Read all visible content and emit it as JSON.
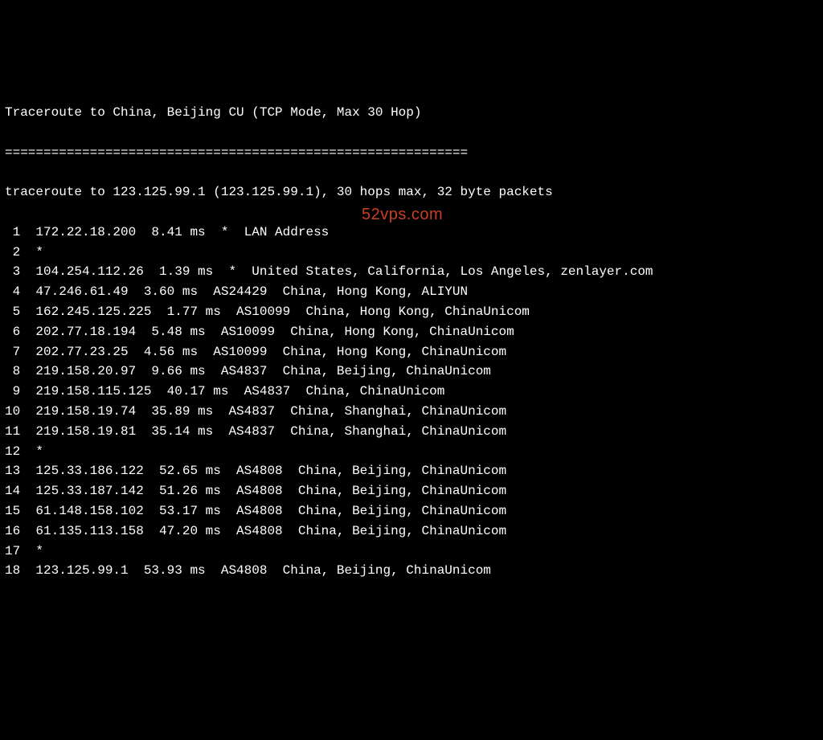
{
  "title": "Traceroute to China, Beijing CU (TCP Mode, Max 30 Hop)",
  "divider": "============================================================",
  "summary": "traceroute to 123.125.99.1 (123.125.99.1), 30 hops max, 32 byte packets",
  "watermark": "52vps.com",
  "hops": [
    {
      "num": "1",
      "ip": "172.22.18.200",
      "rtt": "8.41 ms",
      "asn": "*",
      "loc": "LAN Address"
    },
    {
      "num": "2",
      "ip": "*",
      "rtt": "",
      "asn": "",
      "loc": ""
    },
    {
      "num": "3",
      "ip": "104.254.112.26",
      "rtt": "1.39 ms",
      "asn": "*",
      "loc": "United States, California, Los Angeles, zenlayer.com"
    },
    {
      "num": "4",
      "ip": "47.246.61.49",
      "rtt": "3.60 ms",
      "asn": "AS24429",
      "loc": "China, Hong Kong, ALIYUN"
    },
    {
      "num": "5",
      "ip": "162.245.125.225",
      "rtt": "1.77 ms",
      "asn": "AS10099",
      "loc": "China, Hong Kong, ChinaUnicom"
    },
    {
      "num": "6",
      "ip": "202.77.18.194",
      "rtt": "5.48 ms",
      "asn": "AS10099",
      "loc": "China, Hong Kong, ChinaUnicom"
    },
    {
      "num": "7",
      "ip": "202.77.23.25",
      "rtt": "4.56 ms",
      "asn": "AS10099",
      "loc": "China, Hong Kong, ChinaUnicom"
    },
    {
      "num": "8",
      "ip": "219.158.20.97",
      "rtt": "9.66 ms",
      "asn": "AS4837",
      "loc": "China, Beijing, ChinaUnicom"
    },
    {
      "num": "9",
      "ip": "219.158.115.125",
      "rtt": "40.17 ms",
      "asn": "AS4837",
      "loc": "China, ChinaUnicom"
    },
    {
      "num": "10",
      "ip": "219.158.19.74",
      "rtt": "35.89 ms",
      "asn": "AS4837",
      "loc": "China, Shanghai, ChinaUnicom"
    },
    {
      "num": "11",
      "ip": "219.158.19.81",
      "rtt": "35.14 ms",
      "asn": "AS4837",
      "loc": "China, Shanghai, ChinaUnicom"
    },
    {
      "num": "12",
      "ip": "*",
      "rtt": "",
      "asn": "",
      "loc": ""
    },
    {
      "num": "13",
      "ip": "125.33.186.122",
      "rtt": "52.65 ms",
      "asn": "AS4808",
      "loc": "China, Beijing, ChinaUnicom"
    },
    {
      "num": "14",
      "ip": "125.33.187.142",
      "rtt": "51.26 ms",
      "asn": "AS4808",
      "loc": "China, Beijing, ChinaUnicom"
    },
    {
      "num": "15",
      "ip": "61.148.158.102",
      "rtt": "53.17 ms",
      "asn": "AS4808",
      "loc": "China, Beijing, ChinaUnicom"
    },
    {
      "num": "16",
      "ip": "61.135.113.158",
      "rtt": "47.20 ms",
      "asn": "AS4808",
      "loc": "China, Beijing, ChinaUnicom"
    },
    {
      "num": "17",
      "ip": "*",
      "rtt": "",
      "asn": "",
      "loc": ""
    },
    {
      "num": "18",
      "ip": "123.125.99.1",
      "rtt": "53.93 ms",
      "asn": "AS4808",
      "loc": "China, Beijing, ChinaUnicom"
    }
  ]
}
